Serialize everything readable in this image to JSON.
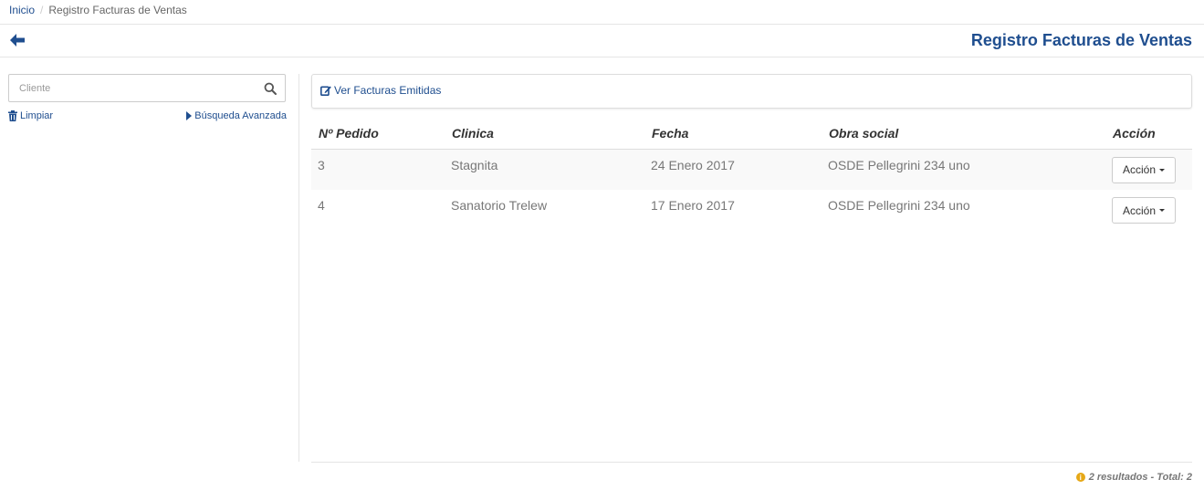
{
  "breadcrumb": {
    "home": "Inicio",
    "separator": "/",
    "current": "Registro Facturas de Ventas"
  },
  "header": {
    "back_icon": "arrow-left-icon",
    "title": "Registro Facturas de Ventas"
  },
  "sidebar": {
    "search": {
      "placeholder": "Cliente",
      "value": "",
      "icon": "search-icon"
    },
    "clear_label": "Limpiar",
    "clear_icon": "trash-icon",
    "advanced_label": "Búsqueda Avanzada",
    "advanced_icon": "caret-right-icon"
  },
  "panel": {
    "link_label": "Ver Facturas Emitidas",
    "link_icon": "edit-icon"
  },
  "table": {
    "columns": [
      "Nº Pedido",
      "Clinica",
      "Fecha",
      "Obra social",
      "Acción"
    ],
    "rows": [
      {
        "pedido": "3",
        "clinica": "Stagnita",
        "fecha": "24 Enero 2017",
        "obra_social": "OSDE Pellegrini 234 uno",
        "action": "Acción"
      },
      {
        "pedido": "4",
        "clinica": "Sanatorio Trelew",
        "fecha": "17 Enero 2017",
        "obra_social": "OSDE Pellegrini 234 uno",
        "action": "Acción"
      }
    ]
  },
  "footer": {
    "status": "2 resultados - Total: 2",
    "icon": "info-icon"
  },
  "colors": {
    "accent": "#1f4e8f",
    "info": "#e6a817"
  }
}
